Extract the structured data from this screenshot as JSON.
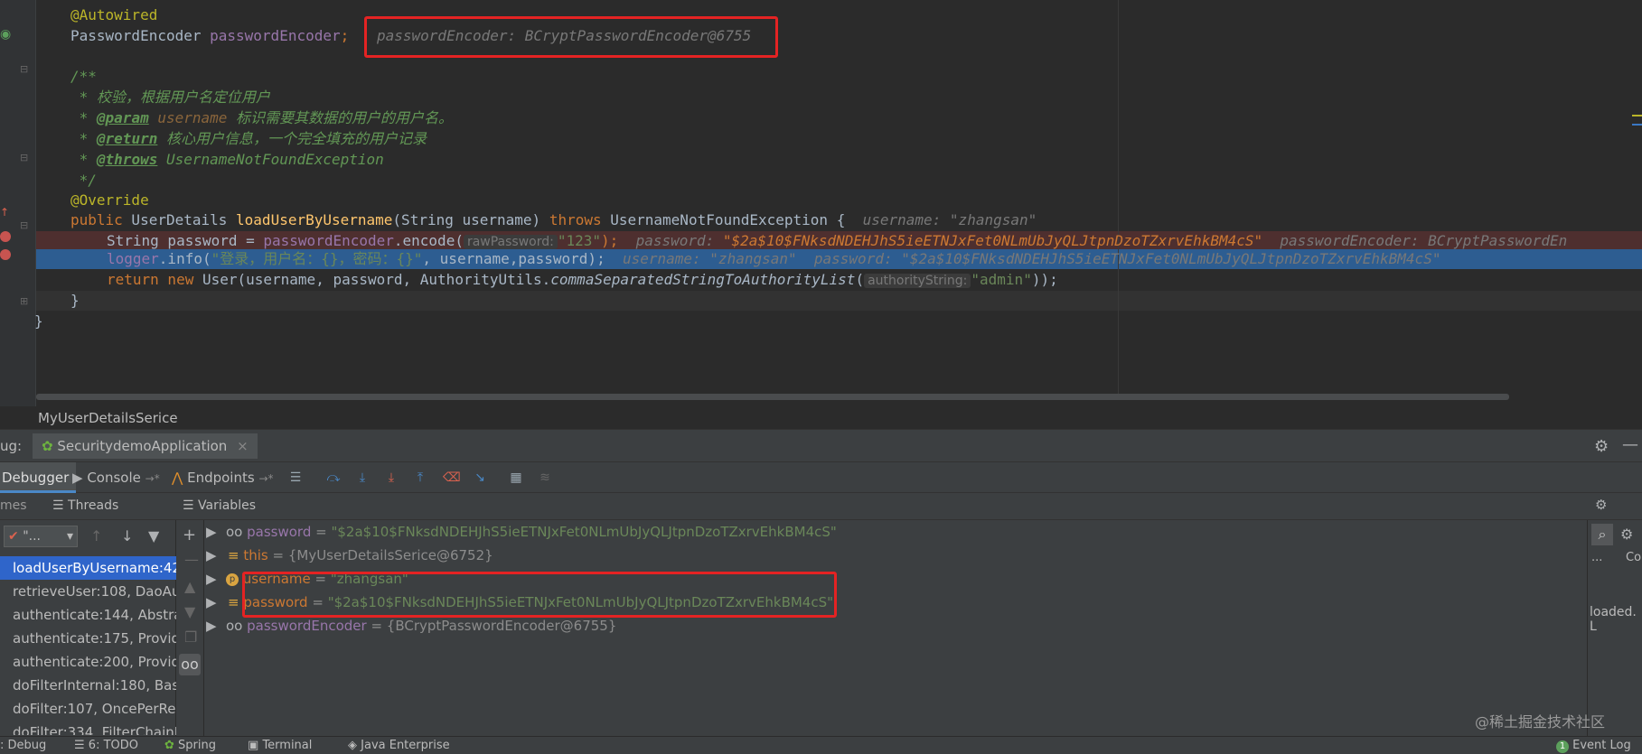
{
  "editor": {
    "lines": {
      "l1": "@Autowired",
      "l2a": "PasswordEncoder ",
      "l2b": "passwordEncoder",
      "l2c": ";",
      "l2hint": "passwordEncoder: BCryptPasswordEncoder@6755",
      "l4": "/**",
      "l5": " * 校验，根据用户名定位用户",
      "l6a": " * ",
      "l6tag": "@param",
      "l6var": " username",
      "l6txt": " 标识需要其数据的用户的用户名。",
      "l7a": " * ",
      "l7tag": "@return",
      "l7txt": " 核心用户信息，一个完全填充的用户记录",
      "l8a": " * ",
      "l8tag": "@throws",
      "l8txt": " UsernameNotFoundException",
      "l9": " */",
      "l10": "@Override",
      "l11kw": "public",
      "l11a": " UserDetails ",
      "l11fn": "loadUserByUsername",
      "l11b": "(String username) ",
      "l11kw2": "throws",
      "l11c": " UsernameNotFoundException {",
      "l11hint": "username: \"zhangsan\"",
      "l12a": "String password = ",
      "l12b": "passwordEncoder",
      "l12c": ".encode(",
      "l12param": "rawPassword:",
      "l12str": "\"123\"",
      "l12d": ");",
      "l12hintLabel": "password: ",
      "l12hintVal": "\"$2a$10$FNksdNDEHJhS5ieETNJxFet0NLmUbJyQLJtpnDzoTZxrvEhkBM4cS\"",
      "l12hint2": "passwordEncoder: BCryptPasswordEn",
      "l13a": "logger",
      "l13b": ".info(",
      "l13str": "\"登录，用户名：{}，密码：{}\"",
      "l13c": ", username,password);",
      "l13hint1": "username: \"zhangsan\"",
      "l13hint2": "password: \"$2a$10$FNksdNDEHJhS5ieETNJxFet0NLmUbJyQLJtpnDzoTZxrvEhkBM4cS\"",
      "l14kw": "return new",
      "l14a": " User(username, password, AuthorityUtils.",
      "l14fn": "commaSeparatedStringToAuthorityList",
      "l14b": "(",
      "l14param": "authorityString:",
      "l14str": "\"admin\"",
      "l14c": "));",
      "l15": "}",
      "l16": "}"
    },
    "breadcrumb": "MyUserDetailsSerice"
  },
  "debug": {
    "label": "ug:",
    "run_config": "SecuritydemoApplication",
    "tabs": {
      "debugger": "Debugger",
      "console": "Console",
      "endpoints": "Endpoints"
    },
    "frames_header": "mes",
    "threads_header": "Threads",
    "thread_select": "\"...",
    "variables_header": "Variables",
    "frames": [
      "loadUserByUsername:42,",
      "retrieveUser:108, DaoAut",
      "authenticate:144, Abstrac",
      "authenticate:175, Provide",
      "authenticate:200, Provide",
      "doFilterInternal:180, Basi",
      "doFilter:107, OncePerRec",
      "doFilter:334, FilterChainP"
    ],
    "variables": [
      {
        "name": "password",
        "eq": " = ",
        "value": "\"$2a$10$FNksdNDEHJhS5ieETNJxFet0NLmUbJyQLJtpnDzoTZxrvEhkBM4cS\""
      },
      {
        "name": "this",
        "eq": " = ",
        "value": "{MyUserDetailsSerice@6752}"
      },
      {
        "name": "username",
        "eq": " = ",
        "value": "\"zhangsan\""
      },
      {
        "name": "password",
        "eq": " = ",
        "value": "\"$2a$10$FNksdNDEHJhS5ieETNJxFet0NLmUbJyQLJtpnDzoTZxrvEhkBM4cS\""
      },
      {
        "name": "passwordEncoder",
        "eq": " = ",
        "value": "{BCryptPasswordEncoder@6755}"
      }
    ],
    "right_panel": {
      "col": "Co",
      "ellipsis": "...",
      "loaded": "loaded. L"
    }
  },
  "statusbar": {
    "debug": ": Debug",
    "todo": "6: TODO",
    "spring": "Spring",
    "terminal": "Terminal",
    "java_enterprise": "Java Enterprise",
    "event_log": "Event Log",
    "event_count": "1"
  },
  "watermark": "@稀土掘金技术社区"
}
